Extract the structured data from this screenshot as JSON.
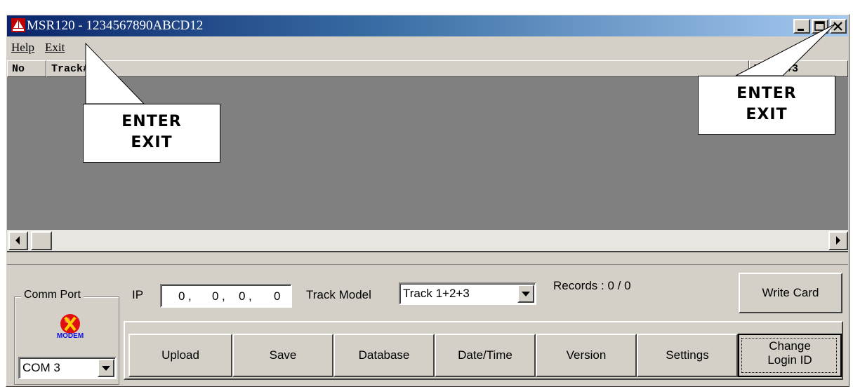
{
  "window": {
    "title": "MSR120 - 1234567890ABCD12"
  },
  "menu": {
    "help": "Help",
    "exit": "Exit"
  },
  "list": {
    "columns": [
      "No",
      "Track#",
      "Track#3"
    ],
    "rows": []
  },
  "comm_port": {
    "label": "Comm Port",
    "status_icon": "modem-disconnected-icon",
    "icon_text": "MODEM",
    "port_value": "COM 3"
  },
  "ip": {
    "label": "IP",
    "octets": [
      "0",
      "0",
      "0",
      "0"
    ]
  },
  "track_model": {
    "label": "Track Model",
    "selected": "Track 1+2+3"
  },
  "records": {
    "text": "Records : 0 / 0"
  },
  "buttons": {
    "write_card": "Write Card",
    "upload": "Upload",
    "save": "Save",
    "database": "Database",
    "date_time": "Date/Time",
    "version": "Version",
    "settings": "Settings",
    "change_login_line1": "Change",
    "change_login_line2": "Login ID"
  },
  "callouts": {
    "left_line1": "ENTER",
    "left_line2": "EXIT",
    "right_line1": "ENTER",
    "right_line2": "EXIT"
  },
  "colors": {
    "titlebar_start": "#0a246a",
    "titlebar_end": "#a6caf0",
    "face": "#d4d0c8",
    "list_bg": "#808080",
    "status_red": "#e01010"
  }
}
